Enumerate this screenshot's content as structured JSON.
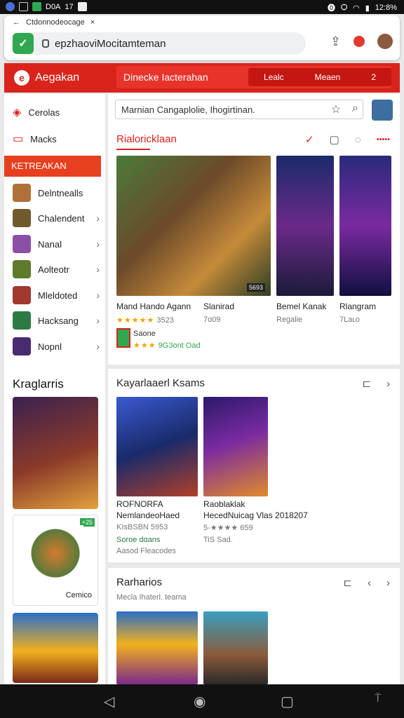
{
  "status": {
    "time": "12:8%",
    "left_icons": [
      "J",
      "◻",
      "▬",
      "D0A",
      "17",
      "◻"
    ]
  },
  "browser": {
    "tab_label": "Ctdonnodeocage",
    "tab_close": "×",
    "url": "epzhaoviMocitamteman",
    "icons": [
      "share-icon",
      "notification-icon",
      "profile-avatar"
    ]
  },
  "appbar": {
    "logo_letter": "e",
    "app_name": "Aegakan",
    "nav_title": "Dinecke Iacterahan",
    "btn1": "Lealc",
    "btn2": "Meaen",
    "btn3": "2",
    "accent": "#d9241c"
  },
  "sidebar": {
    "top_items": [
      {
        "label": "Cerolas",
        "icon": "controller-icon"
      },
      {
        "label": "Macks",
        "icon": "tablet-icon"
      }
    ],
    "active_label": "KETREAKAN",
    "list": [
      {
        "label": "Delntnealls"
      },
      {
        "label": "Chalendent"
      },
      {
        "label": "Nanal"
      },
      {
        "label": "Aolteotr"
      },
      {
        "label": "Mleldoted"
      },
      {
        "label": "Hacksang"
      },
      {
        "label": "Nopnl"
      }
    ],
    "heading": "Kraglarris",
    "card2_badge": "+25",
    "card2_caption": "Cemico"
  },
  "search": {
    "value": "Marnian Cangaplolie, Ihogirtinan."
  },
  "featured": {
    "title": "Rialoricklaan",
    "games": [
      {
        "name": "Mand Hando Agann",
        "meta": "3523",
        "badge": "5693"
      },
      {
        "name": "Slanirad",
        "meta": "7ɑ09"
      },
      {
        "name": "Bemel Kanak",
        "meta": "Regalie"
      },
      {
        "name": "Rlangram",
        "meta": "7Laʟo"
      }
    ],
    "promo_name": "Saone",
    "promo_price": "9G3ont Oad"
  },
  "section2": {
    "title": "Kayarlaaerl Ksams",
    "games": [
      {
        "line1": "ROFNORFA",
        "line2": "NemlandeoHaed",
        "meta": "KIsBSBN 5953",
        "small1": "Soroe dɑans",
        "small2": "Aasod Fleacodes"
      },
      {
        "line1": "Raoblaklak",
        "line2": "HecedNuicag Vlas 2018207",
        "meta": "5-★★★★ 659",
        "small1": "TiS Sad."
      }
    ]
  },
  "section3": {
    "title": "Rarharios",
    "subtitle": "Mecla Ihaterl. teama"
  }
}
